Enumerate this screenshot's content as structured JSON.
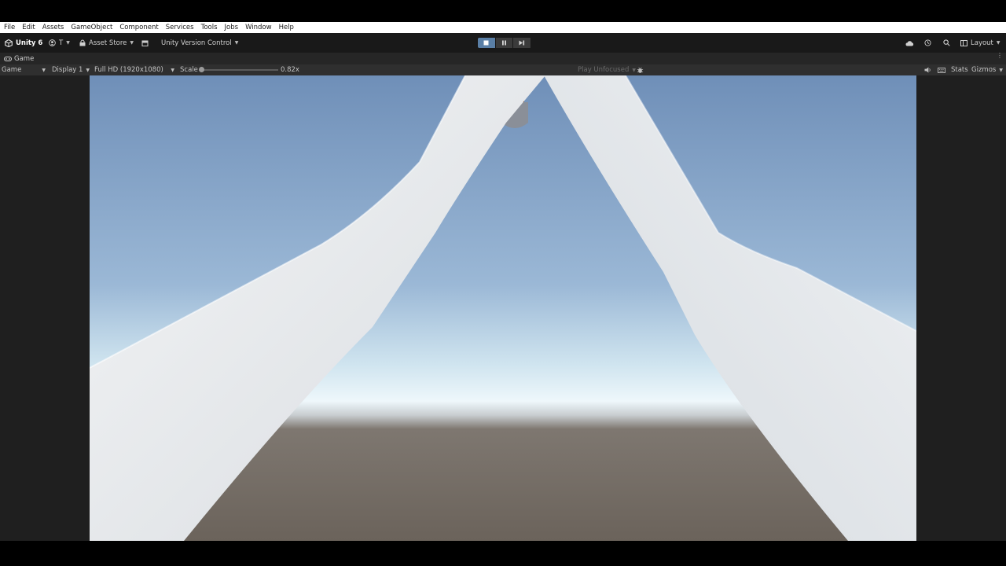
{
  "menu": [
    "File",
    "Edit",
    "Assets",
    "GameObject",
    "Component",
    "Services",
    "Tools",
    "Jobs",
    "Window",
    "Help"
  ],
  "toolbar": {
    "unity_label": "Unity 6",
    "account_label": "T",
    "asset_store_label": "Asset Store",
    "version_control_label": "Unity Version Control",
    "layout_label": "Layout"
  },
  "tab": {
    "title": "Game"
  },
  "gamebar": {
    "view_mode": "Game",
    "display": "Display 1",
    "resolution": "Full HD (1920x1080)",
    "scale_label": "Scale",
    "scale_value": "0.82x",
    "play_focus": "Play Unfocused",
    "stats_label": "Stats",
    "gizmos_label": "Gizmos"
  },
  "colors": {
    "play_active": "#5a7fa6",
    "sky_top": "#6f8fb8",
    "horizon": "#e6f2f8",
    "ground": "#6d655d",
    "arm": "#e6e8ea"
  },
  "scene": {
    "description_icons": [
      "left-arm",
      "right-arm",
      "held-object"
    ]
  }
}
